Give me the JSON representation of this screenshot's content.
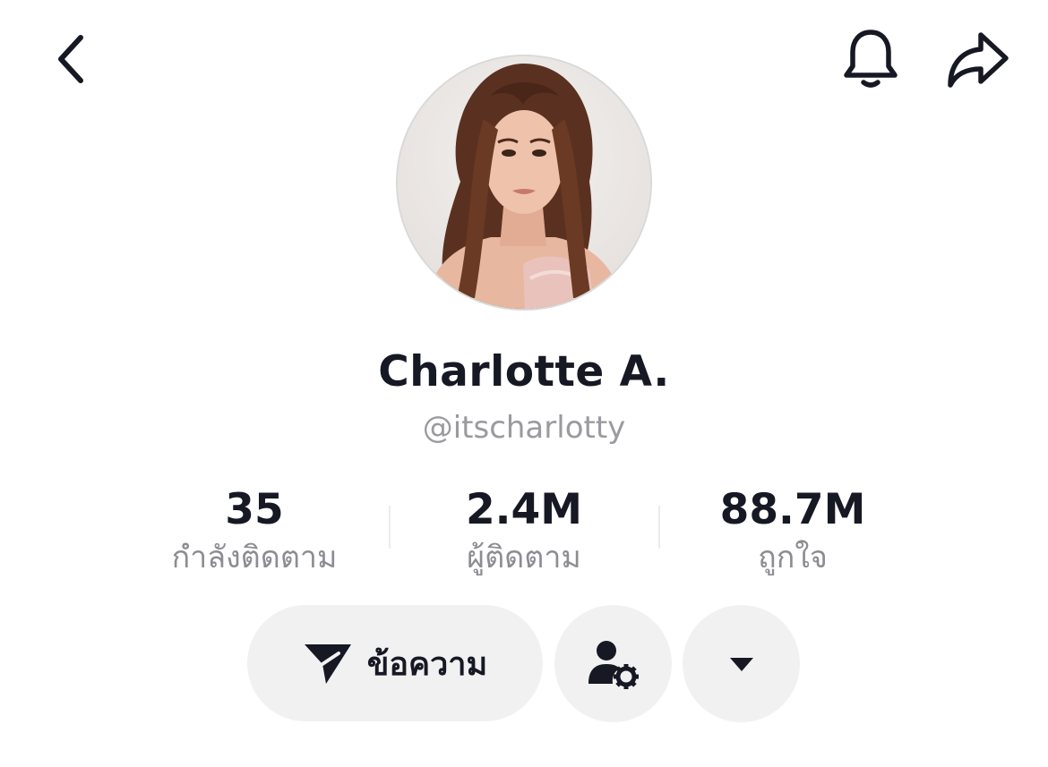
{
  "profile": {
    "display_name": "Charlotte A.",
    "handle": "@itscharlotty"
  },
  "stats": {
    "following": {
      "value": "35",
      "label": "กำลังติดตาม"
    },
    "followers": {
      "value": "2.4M",
      "label": "ผู้ติดตาม"
    },
    "likes": {
      "value": "88.7M",
      "label": "ถูกใจ"
    }
  },
  "actions": {
    "message_label": "ข้อความ"
  },
  "icons": {
    "back": "chevron-left-icon",
    "notifications": "bell-icon",
    "share": "share-arrow-icon",
    "message": "paper-plane-icon",
    "manage": "user-gear-icon",
    "more": "caret-down-icon"
  },
  "colors": {
    "text": "#161823",
    "secondary_text": "#8c8c92",
    "button_bg": "#f1f1f2"
  }
}
